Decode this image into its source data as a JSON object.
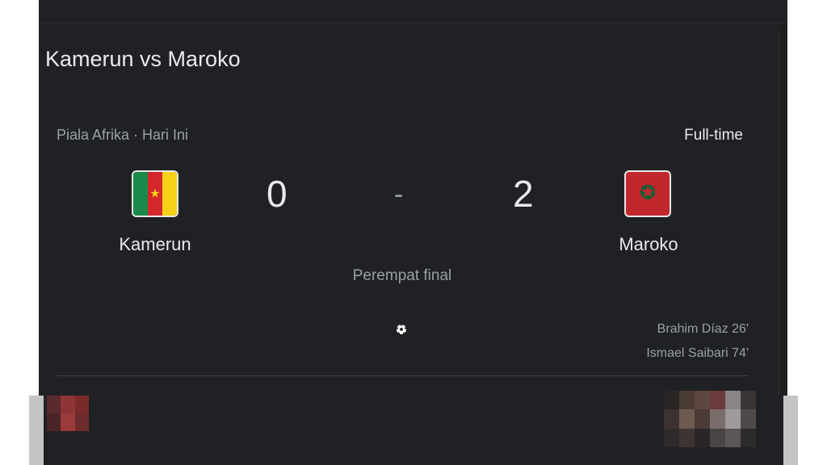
{
  "match": {
    "title": "Kamerun vs Maroko",
    "league": "Piala Afrika · Hari Ini",
    "status": "Full-time",
    "stage": "Perempat final",
    "separator": "-",
    "home": {
      "name": "Kamerun",
      "score": "0",
      "flag_colors": [
        "#1a8a4a",
        "#d3272c",
        "#f7d117"
      ]
    },
    "away": {
      "name": "Maroko",
      "score": "2",
      "flag_colors": [
        "#c1272d",
        "#006233"
      ]
    },
    "goals_away": [
      "Brahim Díaz 26'",
      "Ismael Saibari 74'"
    ]
  },
  "icons": {
    "goal": "soccer-ball-icon",
    "home_flag": "cameroon-flag-icon",
    "away_flag": "morocco-flag-icon"
  }
}
